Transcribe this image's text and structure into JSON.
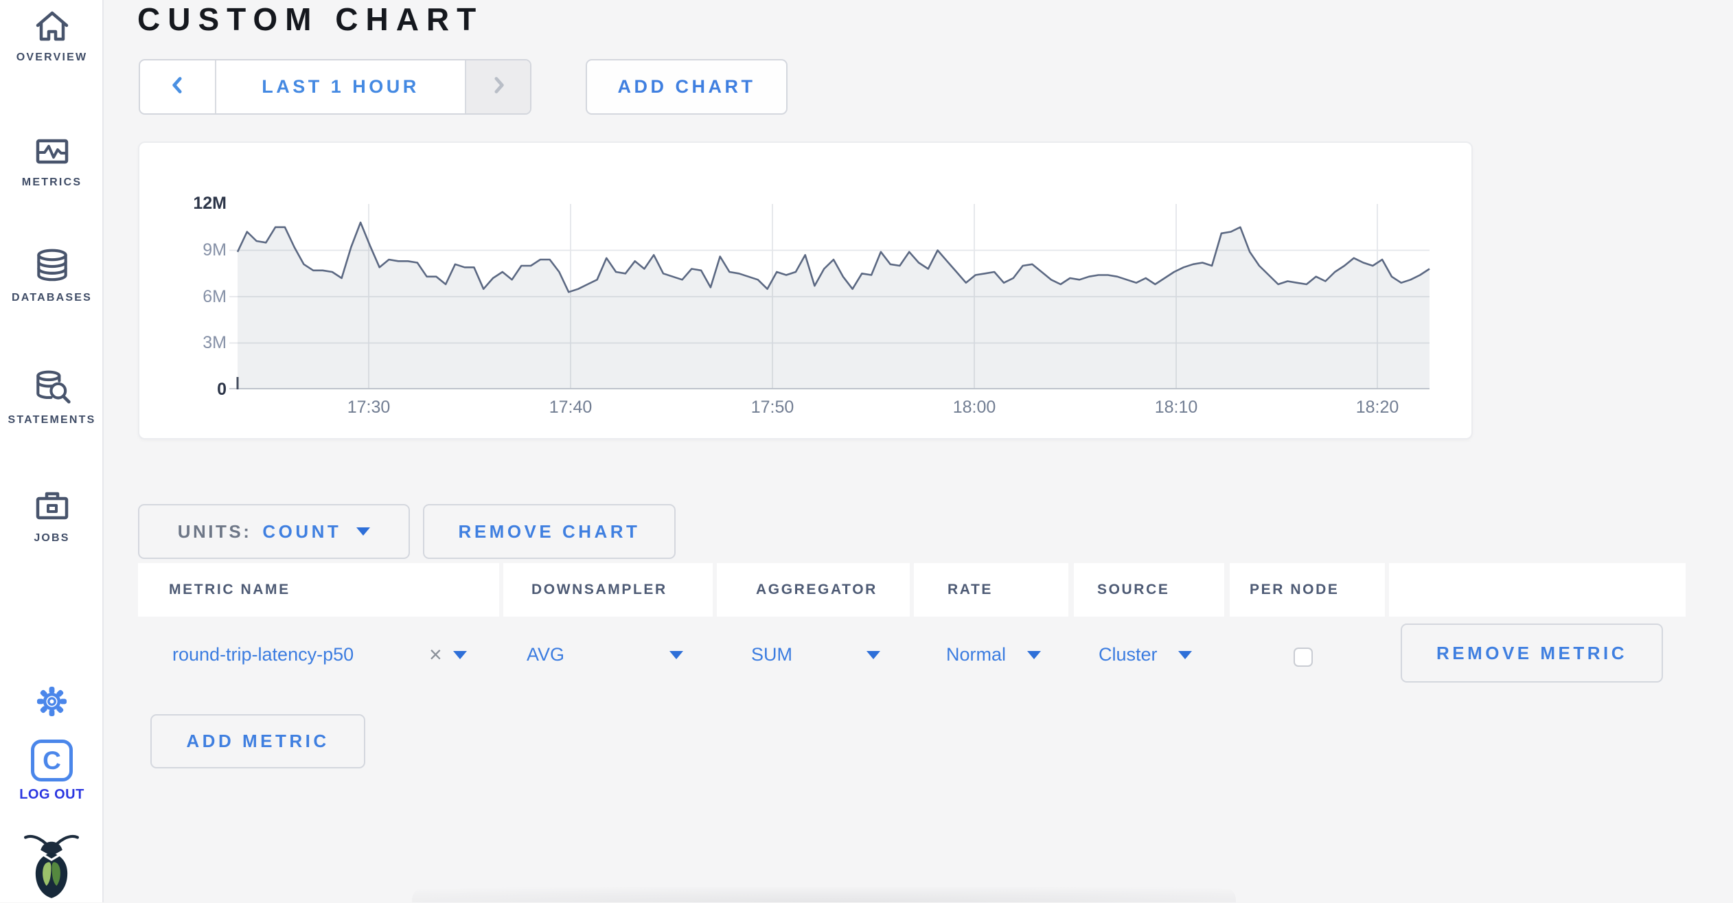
{
  "app": {
    "title": "CUSTOM CHART"
  },
  "sidebar": {
    "items": [
      {
        "label": "OVERVIEW",
        "icon": "home-icon"
      },
      {
        "label": "METRICS",
        "icon": "metrics-icon"
      },
      {
        "label": "DATABASES",
        "icon": "database-icon"
      },
      {
        "label": "STATEMENTS",
        "icon": "statements-icon"
      },
      {
        "label": "JOBS",
        "icon": "briefcase-icon"
      }
    ],
    "logout": {
      "label": "LOG OUT",
      "badge_letter": "C"
    }
  },
  "toolbar": {
    "time_window_label": "LAST 1 HOUR",
    "add_chart_label": "ADD CHART"
  },
  "chart_controls": {
    "units_prefix": "UNITS:",
    "units_value": "COUNT",
    "remove_chart_label": "REMOVE CHART",
    "add_metric_label": "ADD METRIC"
  },
  "metrics_table": {
    "headers": [
      "METRIC NAME",
      "DOWNSAMPLER",
      "AGGREGATOR",
      "RATE",
      "SOURCE",
      "PER NODE",
      ""
    ],
    "rows": [
      {
        "metric_name": "round-trip-latency-p50",
        "downsampler": "AVG",
        "aggregator": "SUM",
        "rate": "Normal",
        "source": "Cluster",
        "per_node_checked": false,
        "remove_label": "REMOVE METRIC"
      }
    ]
  },
  "chart_data": {
    "type": "area",
    "title": "",
    "xlabel": "",
    "ylabel": "count",
    "legend": "none",
    "grid": true,
    "x_ticks": [
      "17:30",
      "17:40",
      "17:50",
      "18:00",
      "18:10",
      "18:20"
    ],
    "y_ticks": [
      "0",
      "3M",
      "6M",
      "9M",
      "12M"
    ],
    "ylim_millions": [
      0,
      12
    ],
    "x_range": "approx 17:23 to 18:23 (last 1 hour)",
    "series": [
      {
        "name": "round-trip-latency-p50",
        "values_millions": [
          8.9,
          10.2,
          9.6,
          9.5,
          10.5,
          10.5,
          9.2,
          8.1,
          7.7,
          7.7,
          7.6,
          7.2,
          9.2,
          10.8,
          9.3,
          7.9,
          8.4,
          8.3,
          8.3,
          8.2,
          7.3,
          7.3,
          6.8,
          8.1,
          7.9,
          7.9,
          6.5,
          7.2,
          7.6,
          7.1,
          8.0,
          8.0,
          8.4,
          8.4,
          7.6,
          6.3,
          6.5,
          6.8,
          7.1,
          8.5,
          7.6,
          7.5,
          8.3,
          7.8,
          8.7,
          7.5,
          7.3,
          7.1,
          7.8,
          7.7,
          6.6,
          8.6,
          7.6,
          7.5,
          7.3,
          7.1,
          6.5,
          7.6,
          7.4,
          7.6,
          8.7,
          6.7,
          7.8,
          8.4,
          7.3,
          6.5,
          7.5,
          7.4,
          8.9,
          8.1,
          8.0,
          8.9,
          8.2,
          7.8,
          9.0,
          8.3,
          7.6,
          6.9,
          7.4,
          7.5,
          7.6,
          6.9,
          7.2,
          8.0,
          8.1,
          7.6,
          7.1,
          6.8,
          7.2,
          7.1,
          7.3,
          7.4,
          7.4,
          7.3,
          7.1,
          6.9,
          7.2,
          6.8,
          7.2,
          7.6,
          7.9,
          8.1,
          8.2,
          8.0,
          10.1,
          10.2,
          10.5,
          8.9,
          8.0,
          7.4,
          6.8,
          7.0,
          6.9,
          6.8,
          7.3,
          7.0,
          7.6,
          8.0,
          8.5,
          8.2,
          8.0,
          8.4,
          7.3,
          6.9,
          7.1,
          7.4,
          7.8
        ]
      }
    ]
  },
  "colors": {
    "accent_blue": "#3f7fe0",
    "logout_blue": "#2b36e0",
    "icon_blue": "#4a86ea",
    "sidebar_slate": "#3f4c66",
    "chart_line": "#5b6882",
    "chart_fill": "rgba(91,104,130,0.10)",
    "page_background": "#f5f5f6"
  }
}
